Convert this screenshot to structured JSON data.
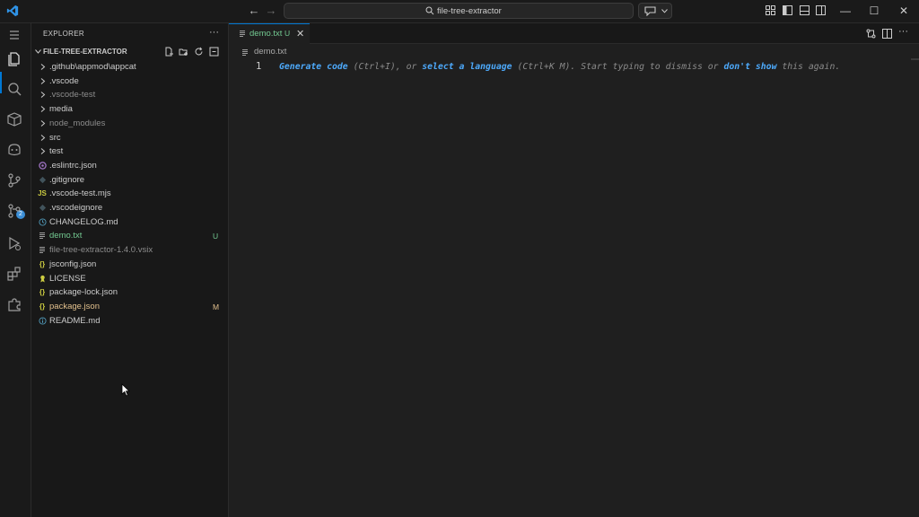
{
  "titlebar": {
    "search_label": "file-tree-extractor"
  },
  "activity_bar": {
    "items": [
      "explorer-icon",
      "search-icon",
      "remote-explorer-icon",
      "copilot-icon",
      "source-control-icon",
      "git-graph-icon",
      "run-debug-icon",
      "extensions-icon",
      "puzzle-icon"
    ],
    "source_control_badge": "2"
  },
  "sidebar": {
    "title": "EXPLORER",
    "more": "···",
    "folder_name": "FILE-TREE-EXTRACTOR",
    "items": [
      {
        "label": ".github\\appmod\\appcat",
        "kind": "folder",
        "color": "#cccccc",
        "status": ""
      },
      {
        "label": ".vscode",
        "kind": "folder",
        "color": "#cccccc",
        "status": ""
      },
      {
        "label": ".vscode-test",
        "kind": "folder",
        "color": "#8c8c8c",
        "status": ""
      },
      {
        "label": "media",
        "kind": "folder",
        "color": "#cccccc",
        "status": ""
      },
      {
        "label": "node_modules",
        "kind": "folder",
        "color": "#8c8c8c",
        "status": ""
      },
      {
        "label": "src",
        "kind": "folder",
        "color": "#cccccc",
        "status": ""
      },
      {
        "label": "test",
        "kind": "folder",
        "color": "#cccccc",
        "status": ""
      },
      {
        "label": ".eslintrc.json",
        "kind": "eslint",
        "color": "#cccccc",
        "status": ""
      },
      {
        "label": ".gitignore",
        "kind": "git",
        "color": "#cccccc",
        "status": ""
      },
      {
        "label": ".vscode-test.mjs",
        "kind": "js",
        "color": "#cccccc",
        "status": ""
      },
      {
        "label": ".vscodeignore",
        "kind": "git",
        "color": "#cccccc",
        "status": ""
      },
      {
        "label": "CHANGELOG.md",
        "kind": "changelog",
        "color": "#cccccc",
        "status": ""
      },
      {
        "label": "demo.txt",
        "kind": "txt",
        "color": "#73c991",
        "status": "U",
        "status_color": "#73c991"
      },
      {
        "label": "file-tree-extractor-1.4.0.vsix",
        "kind": "txt",
        "color": "#8c8c8c",
        "status": ""
      },
      {
        "label": "jsconfig.json",
        "kind": "json",
        "color": "#cccccc",
        "status": ""
      },
      {
        "label": "LICENSE",
        "kind": "license",
        "color": "#cccccc",
        "status": ""
      },
      {
        "label": "package-lock.json",
        "kind": "json",
        "color": "#cccccc",
        "status": ""
      },
      {
        "label": "package.json",
        "kind": "json",
        "color": "#e2c08d",
        "status": "M",
        "status_color": "#e2c08d"
      },
      {
        "label": "README.md",
        "kind": "readme",
        "color": "#cccccc",
        "status": ""
      }
    ]
  },
  "editor": {
    "tab": {
      "label": "demo.txt",
      "status": "U",
      "close": "✕"
    },
    "breadcrumb": "demo.txt",
    "line_number": "1",
    "hint": {
      "link1": "Generate code",
      "text1": " (Ctrl+I), or ",
      "link2": "select a language",
      "text2": " (Ctrl+K M). Start typing to dismiss or ",
      "link3": "don't show",
      "text3": " this again."
    }
  },
  "colors": {
    "accent": "#0078d4",
    "link": "#4daafc",
    "untracked": "#73c991",
    "modified": "#e2c08d"
  }
}
